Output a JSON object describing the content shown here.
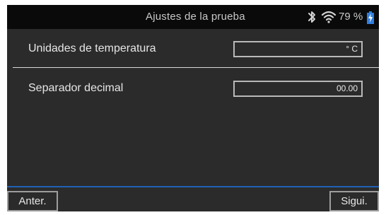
{
  "header": {
    "title": "Ajustes de la prueba",
    "battery_percent": "79 %",
    "icons": [
      "bluetooth-icon",
      "wifi-icon",
      "battery-charging-icon"
    ]
  },
  "settings": [
    {
      "label": "Unidades de temperatura",
      "value": "° C"
    },
    {
      "label": "Separador decimal",
      "value": "00.00"
    }
  ],
  "footer": {
    "prev_label": "Anter.",
    "next_label": "Sigui."
  },
  "colors": {
    "background": "#2b2b2b",
    "header_bg": "#0a0a0a",
    "accent": "#1f62b5",
    "battery": "#2f7fe0"
  }
}
